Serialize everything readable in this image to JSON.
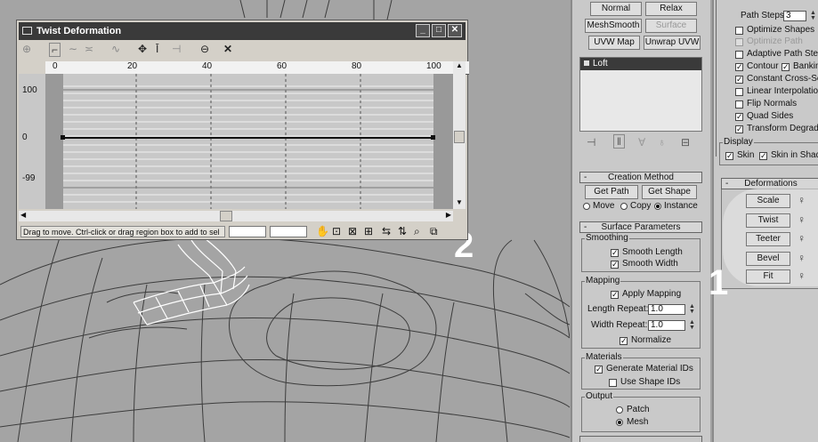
{
  "twist_window": {
    "title": "Twist Deformation",
    "ruler_labels": [
      "0",
      "20",
      "40",
      "60",
      "80",
      "100"
    ],
    "y_labels": [
      "100",
      "0",
      "-99"
    ],
    "status_message": "Drag to move. Ctrl-click or drag region box to add to sel",
    "toolbar_icons": [
      "link-xy-icon",
      "move-control-point-icon",
      "scale-control-point-icon",
      "insert-corner-point-icon",
      "delete-control-point-icon",
      "reset-curve-icon"
    ]
  },
  "badges": {
    "one": "1",
    "two": "2"
  },
  "panel_top": {
    "normal": "Normal",
    "relax": "Relax",
    "meshsmooth": "MeshSmooth",
    "surface": "Surface",
    "uvw_map": "UVW Map",
    "unwrap_uvw": "Unwrap UVW"
  },
  "modifier_stack": {
    "items": [
      "Loft"
    ]
  },
  "creation_method": {
    "header": "Creation Method",
    "get_path": "Get Path",
    "get_shape": "Get Shape",
    "move": "Move",
    "copy": "Copy",
    "instance": "Instance"
  },
  "surface_parameters": {
    "header": "Surface Parameters",
    "smoothing": "Smoothing",
    "smooth_length": "Smooth Length",
    "smooth_width": "Smooth Width",
    "mapping": "Mapping",
    "apply_mapping": "Apply Mapping",
    "length_repeat": "Length Repeat:",
    "length_repeat_value": "1.0",
    "width_repeat": "Width Repeat:",
    "width_repeat_value": "1.0",
    "normalize": "Normalize",
    "materials": "Materials",
    "generate_material_ids": "Generate Material IDs",
    "use_shape_ids": "Use Shape IDs",
    "output": "Output",
    "patch": "Patch",
    "mesh": "Mesh"
  },
  "path_parameters": {
    "path_steps": "Path Steps:",
    "path_steps_value": "3",
    "optimize_shapes": "Optimize Shapes",
    "optimize_path": "Optimize Path",
    "adaptive_path_steps": "Adaptive Path Steps",
    "contour": "Contour",
    "banking": "Banking",
    "constant_cross_section": "Constant Cross-Section",
    "linear_interpolation": "Linear Interpolation",
    "flip_normals": "Flip Normals",
    "quad_sides": "Quad Sides",
    "transform_degrade": "Transform Degrade"
  },
  "display": {
    "label": "Display",
    "skin": "Skin",
    "skin_in_shaded": "Skin in Shaded"
  },
  "deformations": {
    "header": "Deformations",
    "scale": "Scale",
    "twist": "Twist",
    "teeter": "Teeter",
    "bevel": "Bevel",
    "fit": "Fit"
  }
}
